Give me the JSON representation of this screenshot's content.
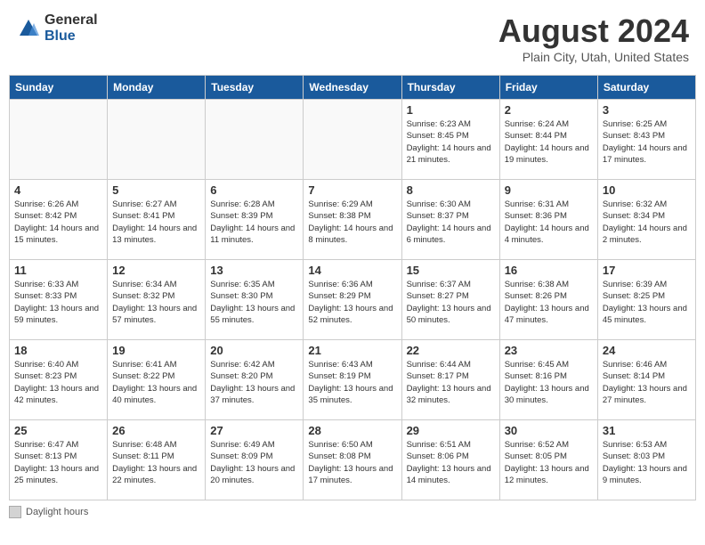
{
  "header": {
    "logo_general": "General",
    "logo_blue": "Blue",
    "month_title": "August 2024",
    "location": "Plain City, Utah, United States"
  },
  "weekdays": [
    "Sunday",
    "Monday",
    "Tuesday",
    "Wednesday",
    "Thursday",
    "Friday",
    "Saturday"
  ],
  "footer": {
    "daylight_label": "Daylight hours"
  },
  "weeks": [
    [
      {
        "day": "",
        "info": ""
      },
      {
        "day": "",
        "info": ""
      },
      {
        "day": "",
        "info": ""
      },
      {
        "day": "",
        "info": ""
      },
      {
        "day": "1",
        "info": "Sunrise: 6:23 AM\nSunset: 8:45 PM\nDaylight: 14 hours and 21 minutes."
      },
      {
        "day": "2",
        "info": "Sunrise: 6:24 AM\nSunset: 8:44 PM\nDaylight: 14 hours and 19 minutes."
      },
      {
        "day": "3",
        "info": "Sunrise: 6:25 AM\nSunset: 8:43 PM\nDaylight: 14 hours and 17 minutes."
      }
    ],
    [
      {
        "day": "4",
        "info": "Sunrise: 6:26 AM\nSunset: 8:42 PM\nDaylight: 14 hours and 15 minutes."
      },
      {
        "day": "5",
        "info": "Sunrise: 6:27 AM\nSunset: 8:41 PM\nDaylight: 14 hours and 13 minutes."
      },
      {
        "day": "6",
        "info": "Sunrise: 6:28 AM\nSunset: 8:39 PM\nDaylight: 14 hours and 11 minutes."
      },
      {
        "day": "7",
        "info": "Sunrise: 6:29 AM\nSunset: 8:38 PM\nDaylight: 14 hours and 8 minutes."
      },
      {
        "day": "8",
        "info": "Sunrise: 6:30 AM\nSunset: 8:37 PM\nDaylight: 14 hours and 6 minutes."
      },
      {
        "day": "9",
        "info": "Sunrise: 6:31 AM\nSunset: 8:36 PM\nDaylight: 14 hours and 4 minutes."
      },
      {
        "day": "10",
        "info": "Sunrise: 6:32 AM\nSunset: 8:34 PM\nDaylight: 14 hours and 2 minutes."
      }
    ],
    [
      {
        "day": "11",
        "info": "Sunrise: 6:33 AM\nSunset: 8:33 PM\nDaylight: 13 hours and 59 minutes."
      },
      {
        "day": "12",
        "info": "Sunrise: 6:34 AM\nSunset: 8:32 PM\nDaylight: 13 hours and 57 minutes."
      },
      {
        "day": "13",
        "info": "Sunrise: 6:35 AM\nSunset: 8:30 PM\nDaylight: 13 hours and 55 minutes."
      },
      {
        "day": "14",
        "info": "Sunrise: 6:36 AM\nSunset: 8:29 PM\nDaylight: 13 hours and 52 minutes."
      },
      {
        "day": "15",
        "info": "Sunrise: 6:37 AM\nSunset: 8:27 PM\nDaylight: 13 hours and 50 minutes."
      },
      {
        "day": "16",
        "info": "Sunrise: 6:38 AM\nSunset: 8:26 PM\nDaylight: 13 hours and 47 minutes."
      },
      {
        "day": "17",
        "info": "Sunrise: 6:39 AM\nSunset: 8:25 PM\nDaylight: 13 hours and 45 minutes."
      }
    ],
    [
      {
        "day": "18",
        "info": "Sunrise: 6:40 AM\nSunset: 8:23 PM\nDaylight: 13 hours and 42 minutes."
      },
      {
        "day": "19",
        "info": "Sunrise: 6:41 AM\nSunset: 8:22 PM\nDaylight: 13 hours and 40 minutes."
      },
      {
        "day": "20",
        "info": "Sunrise: 6:42 AM\nSunset: 8:20 PM\nDaylight: 13 hours and 37 minutes."
      },
      {
        "day": "21",
        "info": "Sunrise: 6:43 AM\nSunset: 8:19 PM\nDaylight: 13 hours and 35 minutes."
      },
      {
        "day": "22",
        "info": "Sunrise: 6:44 AM\nSunset: 8:17 PM\nDaylight: 13 hours and 32 minutes."
      },
      {
        "day": "23",
        "info": "Sunrise: 6:45 AM\nSunset: 8:16 PM\nDaylight: 13 hours and 30 minutes."
      },
      {
        "day": "24",
        "info": "Sunrise: 6:46 AM\nSunset: 8:14 PM\nDaylight: 13 hours and 27 minutes."
      }
    ],
    [
      {
        "day": "25",
        "info": "Sunrise: 6:47 AM\nSunset: 8:13 PM\nDaylight: 13 hours and 25 minutes."
      },
      {
        "day": "26",
        "info": "Sunrise: 6:48 AM\nSunset: 8:11 PM\nDaylight: 13 hours and 22 minutes."
      },
      {
        "day": "27",
        "info": "Sunrise: 6:49 AM\nSunset: 8:09 PM\nDaylight: 13 hours and 20 minutes."
      },
      {
        "day": "28",
        "info": "Sunrise: 6:50 AM\nSunset: 8:08 PM\nDaylight: 13 hours and 17 minutes."
      },
      {
        "day": "29",
        "info": "Sunrise: 6:51 AM\nSunset: 8:06 PM\nDaylight: 13 hours and 14 minutes."
      },
      {
        "day": "30",
        "info": "Sunrise: 6:52 AM\nSunset: 8:05 PM\nDaylight: 13 hours and 12 minutes."
      },
      {
        "day": "31",
        "info": "Sunrise: 6:53 AM\nSunset: 8:03 PM\nDaylight: 13 hours and 9 minutes."
      }
    ]
  ]
}
